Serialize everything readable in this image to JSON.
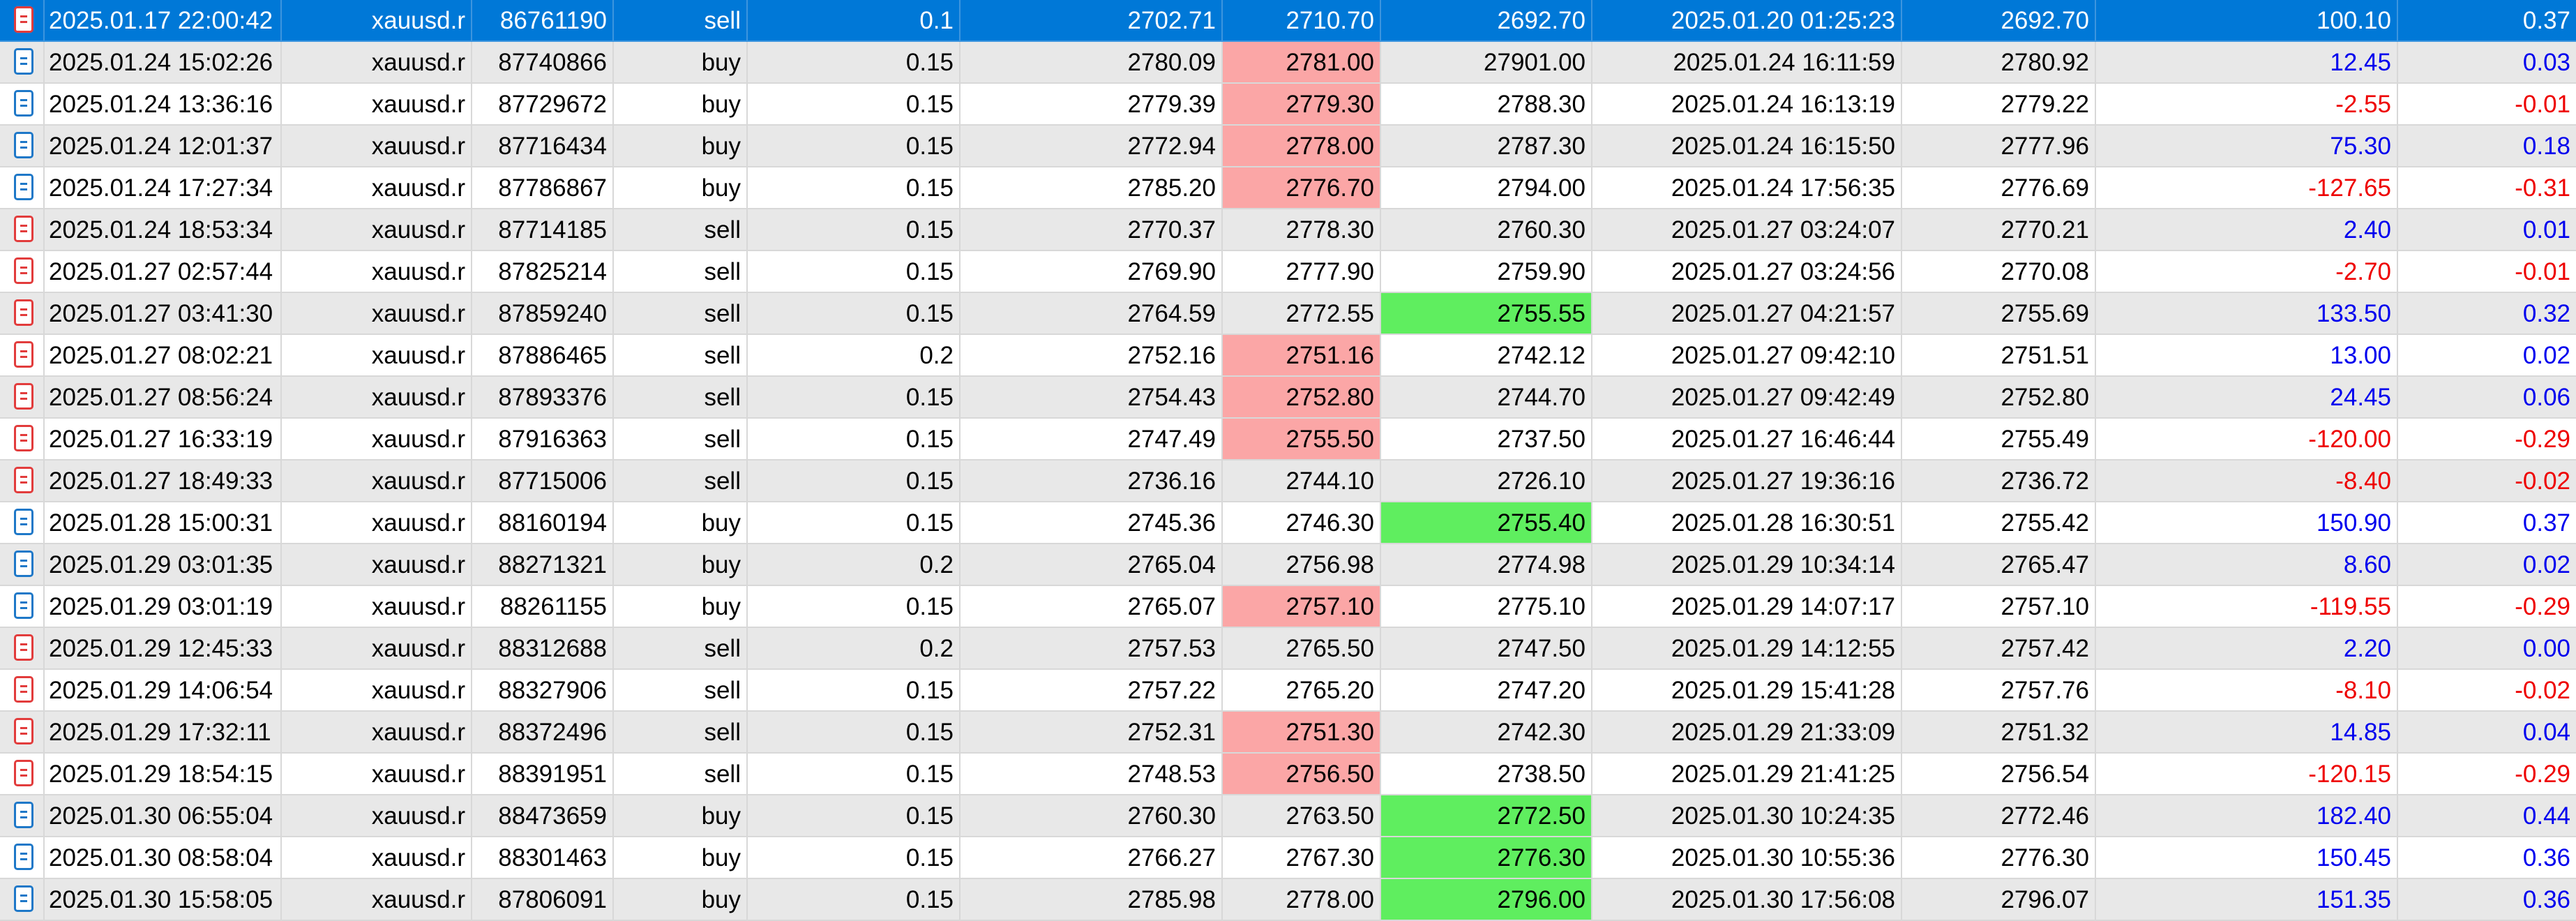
{
  "colors": {
    "selected_row": "#0078d7",
    "alt_row": "#e8e8e8",
    "sl_hit": "#fba6a6",
    "tp_hit": "#5fee5f",
    "profit_positive": "#0000ee",
    "profit_negative": "#ee0000"
  },
  "rows": [
    {
      "open_time": "2025.01.17 22:00:42",
      "symbol": "xauusd.r",
      "ticket": "86761190",
      "type": "sell",
      "volume": "0.1",
      "price": "2702.71",
      "sl": "2710.70",
      "tp": "2692.70",
      "close_time": "2025.01.20 01:25:23",
      "close_price": "2692.70",
      "profit": "100.10",
      "pct": "0.37",
      "selected": true,
      "hit": "none",
      "sign": "pos"
    },
    {
      "open_time": "2025.01.24 15:02:26",
      "symbol": "xauusd.r",
      "ticket": "87740866",
      "type": "buy",
      "volume": "0.15",
      "price": "2780.09",
      "sl": "2781.00",
      "tp": "27901.00",
      "close_time": "2025.01.24 16:11:59",
      "close_price": "2780.92",
      "profit": "12.45",
      "pct": "0.03",
      "selected": false,
      "hit": "sl",
      "sign": "pos"
    },
    {
      "open_time": "2025.01.24 13:36:16",
      "symbol": "xauusd.r",
      "ticket": "87729672",
      "type": "buy",
      "volume": "0.15",
      "price": "2779.39",
      "sl": "2779.30",
      "tp": "2788.30",
      "close_time": "2025.01.24 16:13:19",
      "close_price": "2779.22",
      "profit": "-2.55",
      "pct": "-0.01",
      "selected": false,
      "hit": "sl",
      "sign": "neg"
    },
    {
      "open_time": "2025.01.24 12:01:37",
      "symbol": "xauusd.r",
      "ticket": "87716434",
      "type": "buy",
      "volume": "0.15",
      "price": "2772.94",
      "sl": "2778.00",
      "tp": "2787.30",
      "close_time": "2025.01.24 16:15:50",
      "close_price": "2777.96",
      "profit": "75.30",
      "pct": "0.18",
      "selected": false,
      "hit": "sl",
      "sign": "pos"
    },
    {
      "open_time": "2025.01.24 17:27:34",
      "symbol": "xauusd.r",
      "ticket": "87786867",
      "type": "buy",
      "volume": "0.15",
      "price": "2785.20",
      "sl": "2776.70",
      "tp": "2794.00",
      "close_time": "2025.01.24 17:56:35",
      "close_price": "2776.69",
      "profit": "-127.65",
      "pct": "-0.31",
      "selected": false,
      "hit": "sl",
      "sign": "neg"
    },
    {
      "open_time": "2025.01.24 18:53:34",
      "symbol": "xauusd.r",
      "ticket": "87714185",
      "type": "sell",
      "volume": "0.15",
      "price": "2770.37",
      "sl": "2778.30",
      "tp": "2760.30",
      "close_time": "2025.01.27 03:24:07",
      "close_price": "2770.21",
      "profit": "2.40",
      "pct": "0.01",
      "selected": false,
      "hit": "none",
      "sign": "pos"
    },
    {
      "open_time": "2025.01.27 02:57:44",
      "symbol": "xauusd.r",
      "ticket": "87825214",
      "type": "sell",
      "volume": "0.15",
      "price": "2769.90",
      "sl": "2777.90",
      "tp": "2759.90",
      "close_time": "2025.01.27 03:24:56",
      "close_price": "2770.08",
      "profit": "-2.70",
      "pct": "-0.01",
      "selected": false,
      "hit": "none",
      "sign": "neg"
    },
    {
      "open_time": "2025.01.27 03:41:30",
      "symbol": "xauusd.r",
      "ticket": "87859240",
      "type": "sell",
      "volume": "0.15",
      "price": "2764.59",
      "sl": "2772.55",
      "tp": "2755.55",
      "close_time": "2025.01.27 04:21:57",
      "close_price": "2755.69",
      "profit": "133.50",
      "pct": "0.32",
      "selected": false,
      "hit": "tp",
      "sign": "pos"
    },
    {
      "open_time": "2025.01.27 08:02:21",
      "symbol": "xauusd.r",
      "ticket": "87886465",
      "type": "sell",
      "volume": "0.2",
      "price": "2752.16",
      "sl": "2751.16",
      "tp": "2742.12",
      "close_time": "2025.01.27 09:42:10",
      "close_price": "2751.51",
      "profit": "13.00",
      "pct": "0.02",
      "selected": false,
      "hit": "sl",
      "sign": "pos"
    },
    {
      "open_time": "2025.01.27 08:56:24",
      "symbol": "xauusd.r",
      "ticket": "87893376",
      "type": "sell",
      "volume": "0.15",
      "price": "2754.43",
      "sl": "2752.80",
      "tp": "2744.70",
      "close_time": "2025.01.27 09:42:49",
      "close_price": "2752.80",
      "profit": "24.45",
      "pct": "0.06",
      "selected": false,
      "hit": "sl",
      "sign": "pos"
    },
    {
      "open_time": "2025.01.27 16:33:19",
      "symbol": "xauusd.r",
      "ticket": "87916363",
      "type": "sell",
      "volume": "0.15",
      "price": "2747.49",
      "sl": "2755.50",
      "tp": "2737.50",
      "close_time": "2025.01.27 16:46:44",
      "close_price": "2755.49",
      "profit": "-120.00",
      "pct": "-0.29",
      "selected": false,
      "hit": "sl",
      "sign": "neg"
    },
    {
      "open_time": "2025.01.27 18:49:33",
      "symbol": "xauusd.r",
      "ticket": "87715006",
      "type": "sell",
      "volume": "0.15",
      "price": "2736.16",
      "sl": "2744.10",
      "tp": "2726.10",
      "close_time": "2025.01.27 19:36:16",
      "close_price": "2736.72",
      "profit": "-8.40",
      "pct": "-0.02",
      "selected": false,
      "hit": "none",
      "sign": "neg"
    },
    {
      "open_time": "2025.01.28 15:00:31",
      "symbol": "xauusd.r",
      "ticket": "88160194",
      "type": "buy",
      "volume": "0.15",
      "price": "2745.36",
      "sl": "2746.30",
      "tp": "2755.40",
      "close_time": "2025.01.28 16:30:51",
      "close_price": "2755.42",
      "profit": "150.90",
      "pct": "0.37",
      "selected": false,
      "hit": "tp",
      "sign": "pos"
    },
    {
      "open_time": "2025.01.29 03:01:35",
      "symbol": "xauusd.r",
      "ticket": "88271321",
      "type": "buy",
      "volume": "0.2",
      "price": "2765.04",
      "sl": "2756.98",
      "tp": "2774.98",
      "close_time": "2025.01.29 10:34:14",
      "close_price": "2765.47",
      "profit": "8.60",
      "pct": "0.02",
      "selected": false,
      "hit": "none",
      "sign": "pos"
    },
    {
      "open_time": "2025.01.29 03:01:19",
      "symbol": "xauusd.r",
      "ticket": "88261155",
      "type": "buy",
      "volume": "0.15",
      "price": "2765.07",
      "sl": "2757.10",
      "tp": "2775.10",
      "close_time": "2025.01.29 14:07:17",
      "close_price": "2757.10",
      "profit": "-119.55",
      "pct": "-0.29",
      "selected": false,
      "hit": "sl",
      "sign": "neg"
    },
    {
      "open_time": "2025.01.29 12:45:33",
      "symbol": "xauusd.r",
      "ticket": "88312688",
      "type": "sell",
      "volume": "0.2",
      "price": "2757.53",
      "sl": "2765.50",
      "tp": "2747.50",
      "close_time": "2025.01.29 14:12:55",
      "close_price": "2757.42",
      "profit": "2.20",
      "pct": "0.00",
      "selected": false,
      "hit": "none",
      "sign": "pos"
    },
    {
      "open_time": "2025.01.29 14:06:54",
      "symbol": "xauusd.r",
      "ticket": "88327906",
      "type": "sell",
      "volume": "0.15",
      "price": "2757.22",
      "sl": "2765.20",
      "tp": "2747.20",
      "close_time": "2025.01.29 15:41:28",
      "close_price": "2757.76",
      "profit": "-8.10",
      "pct": "-0.02",
      "selected": false,
      "hit": "none",
      "sign": "neg"
    },
    {
      "open_time": "2025.01.29 17:32:11",
      "symbol": "xauusd.r",
      "ticket": "88372496",
      "type": "sell",
      "volume": "0.15",
      "price": "2752.31",
      "sl": "2751.30",
      "tp": "2742.30",
      "close_time": "2025.01.29 21:33:09",
      "close_price": "2751.32",
      "profit": "14.85",
      "pct": "0.04",
      "selected": false,
      "hit": "sl",
      "sign": "pos"
    },
    {
      "open_time": "2025.01.29 18:54:15",
      "symbol": "xauusd.r",
      "ticket": "88391951",
      "type": "sell",
      "volume": "0.15",
      "price": "2748.53",
      "sl": "2756.50",
      "tp": "2738.50",
      "close_time": "2025.01.29 21:41:25",
      "close_price": "2756.54",
      "profit": "-120.15",
      "pct": "-0.29",
      "selected": false,
      "hit": "sl",
      "sign": "neg"
    },
    {
      "open_time": "2025.01.30 06:55:04",
      "symbol": "xauusd.r",
      "ticket": "88473659",
      "type": "buy",
      "volume": "0.15",
      "price": "2760.30",
      "sl": "2763.50",
      "tp": "2772.50",
      "close_time": "2025.01.30 10:24:35",
      "close_price": "2772.46",
      "profit": "182.40",
      "pct": "0.44",
      "selected": false,
      "hit": "tp",
      "sign": "pos"
    },
    {
      "open_time": "2025.01.30 08:58:04",
      "symbol": "xauusd.r",
      "ticket": "88301463",
      "type": "buy",
      "volume": "0.15",
      "price": "2766.27",
      "sl": "2767.30",
      "tp": "2776.30",
      "close_time": "2025.01.30 10:55:36",
      "close_price": "2776.30",
      "profit": "150.45",
      "pct": "0.36",
      "selected": false,
      "hit": "tp",
      "sign": "pos"
    },
    {
      "open_time": "2025.01.30 15:58:05",
      "symbol": "xauusd.r",
      "ticket": "87806091",
      "type": "buy",
      "volume": "0.15",
      "price": "2785.98",
      "sl": "2778.00",
      "tp": "2796.00",
      "close_time": "2025.01.30 17:56:08",
      "close_price": "2796.07",
      "profit": "151.35",
      "pct": "0.36",
      "selected": false,
      "hit": "tp",
      "sign": "pos"
    }
  ]
}
